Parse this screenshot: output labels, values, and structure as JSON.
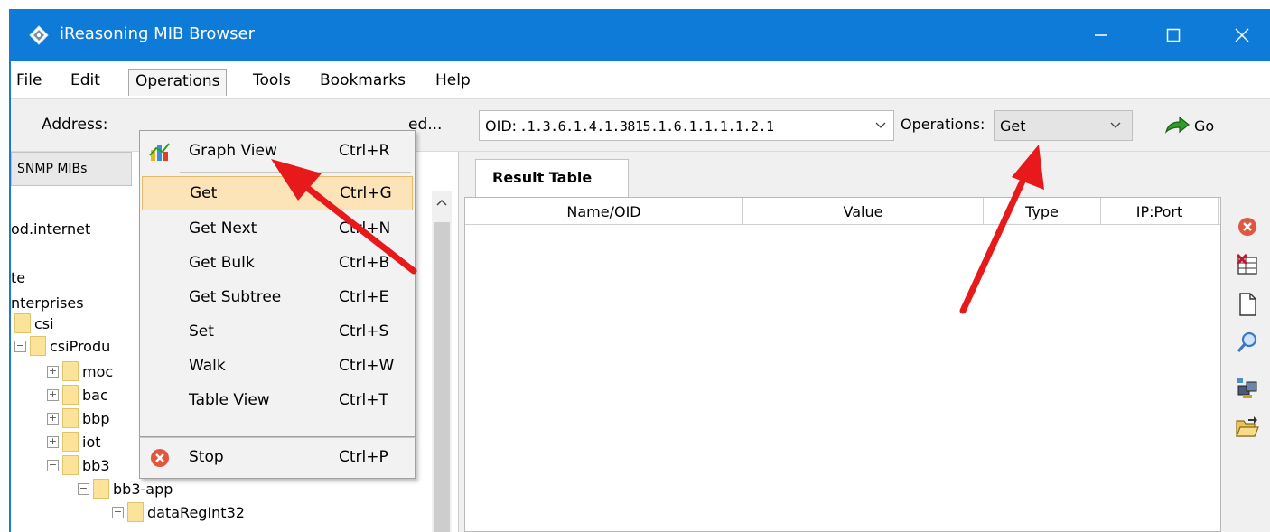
{
  "window": {
    "title": "iReasoning MIB Browser",
    "accent_color": "#0f7bd8"
  },
  "menubar": {
    "items": [
      "File",
      "Edit",
      "Operations",
      "Tools",
      "Bookmarks",
      "Help"
    ],
    "active": "Operations"
  },
  "toolbar": {
    "address_label": "Address:",
    "address_tail": "ed...",
    "oid_label": "OID:",
    "oid_value": ".1.3.6.1.4.1.3815.1.6.1.1.1.1.2.1",
    "operations_label": "Operations:",
    "operations_value": "Get",
    "go_label": "Go"
  },
  "left_panel": {
    "tab_label": "SNMP MIBs",
    "tree": [
      {
        "label": "od.internet"
      },
      {
        "label": "te"
      },
      {
        "label": "nterprises"
      },
      {
        "label": "csi"
      },
      {
        "label": "csiProdu"
      },
      {
        "label": "moc"
      },
      {
        "label": "bac"
      },
      {
        "label": "bbp"
      },
      {
        "label": "iot"
      },
      {
        "label": "bb3"
      },
      {
        "label": "bb3-app"
      },
      {
        "label": "dataRegInt32"
      }
    ]
  },
  "dropdown": {
    "items": [
      {
        "label": "Graph View",
        "shortcut": "Ctrl+R",
        "icon": "graph-icon"
      },
      {
        "label": "Get",
        "shortcut": "Ctrl+G",
        "highlighted": true
      },
      {
        "label": "Get Next",
        "shortcut": "Ctrl+N"
      },
      {
        "label": "Get Bulk",
        "shortcut": "Ctrl+B"
      },
      {
        "label": "Get Subtree",
        "shortcut": "Ctrl+E"
      },
      {
        "label": "Set",
        "shortcut": "Ctrl+S"
      },
      {
        "label": "Walk",
        "shortcut": "Ctrl+W"
      },
      {
        "label": "Table View",
        "shortcut": "Ctrl+T"
      },
      {
        "label": "Stop",
        "shortcut": "Ctrl+P",
        "icon": "stop-icon"
      }
    ],
    "highlight_color": "#fce3b8"
  },
  "right_panel": {
    "tab_label": "Result Table",
    "columns": [
      "Name/OID",
      "Value",
      "Type",
      "IP:Port"
    ],
    "side_tools": [
      "stop-icon",
      "delete-table-icon",
      "new-document-icon",
      "search-icon",
      "network-icon",
      "open-folder-icon"
    ]
  },
  "annotation": {
    "arrow_color": "#e8191a"
  }
}
